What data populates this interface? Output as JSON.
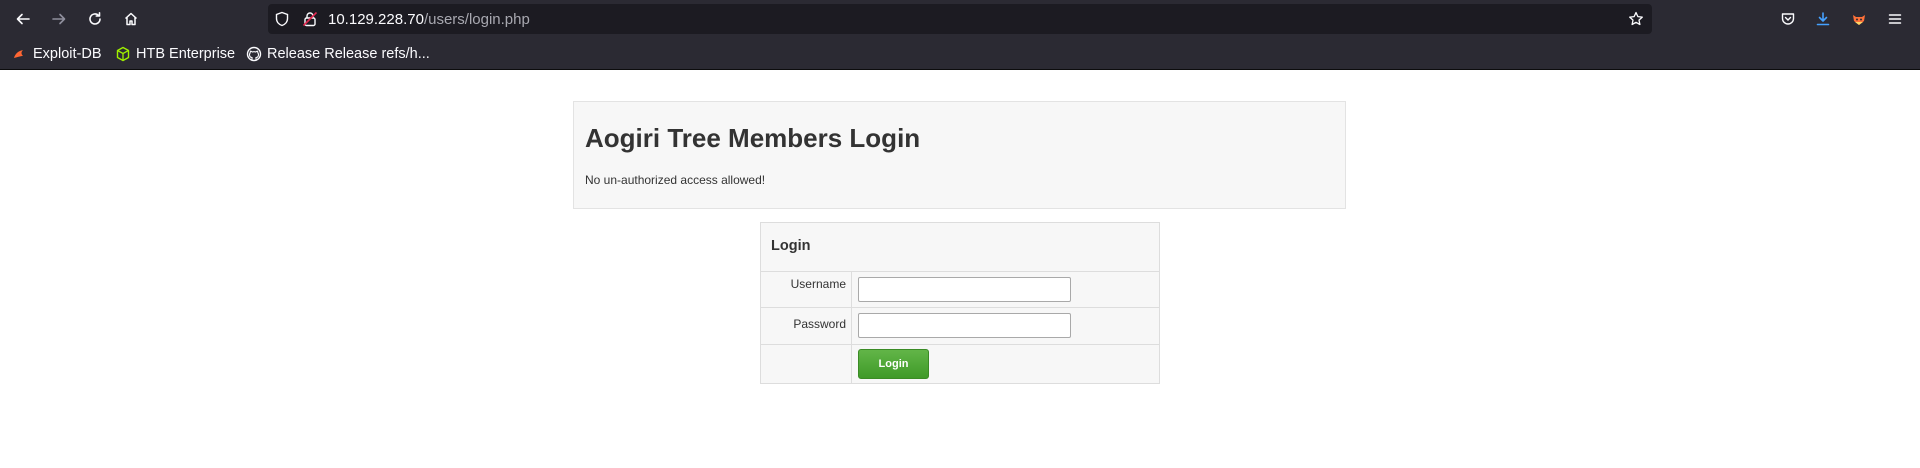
{
  "browser": {
    "url_host": "10.129.228.70",
    "url_path": "/users/login.php",
    "bookmarks": [
      {
        "label": "Exploit-DB"
      },
      {
        "label": "HTB Enterprise"
      },
      {
        "label": "Release Release refs/h..."
      }
    ]
  },
  "header": {
    "title": "Aogiri Tree Members Login",
    "subtitle": "No un-authorized access allowed!"
  },
  "login": {
    "heading": "Login",
    "username_label": "Username",
    "username_value": "",
    "password_label": "Password",
    "password_value": "",
    "submit_label": "Login"
  }
}
